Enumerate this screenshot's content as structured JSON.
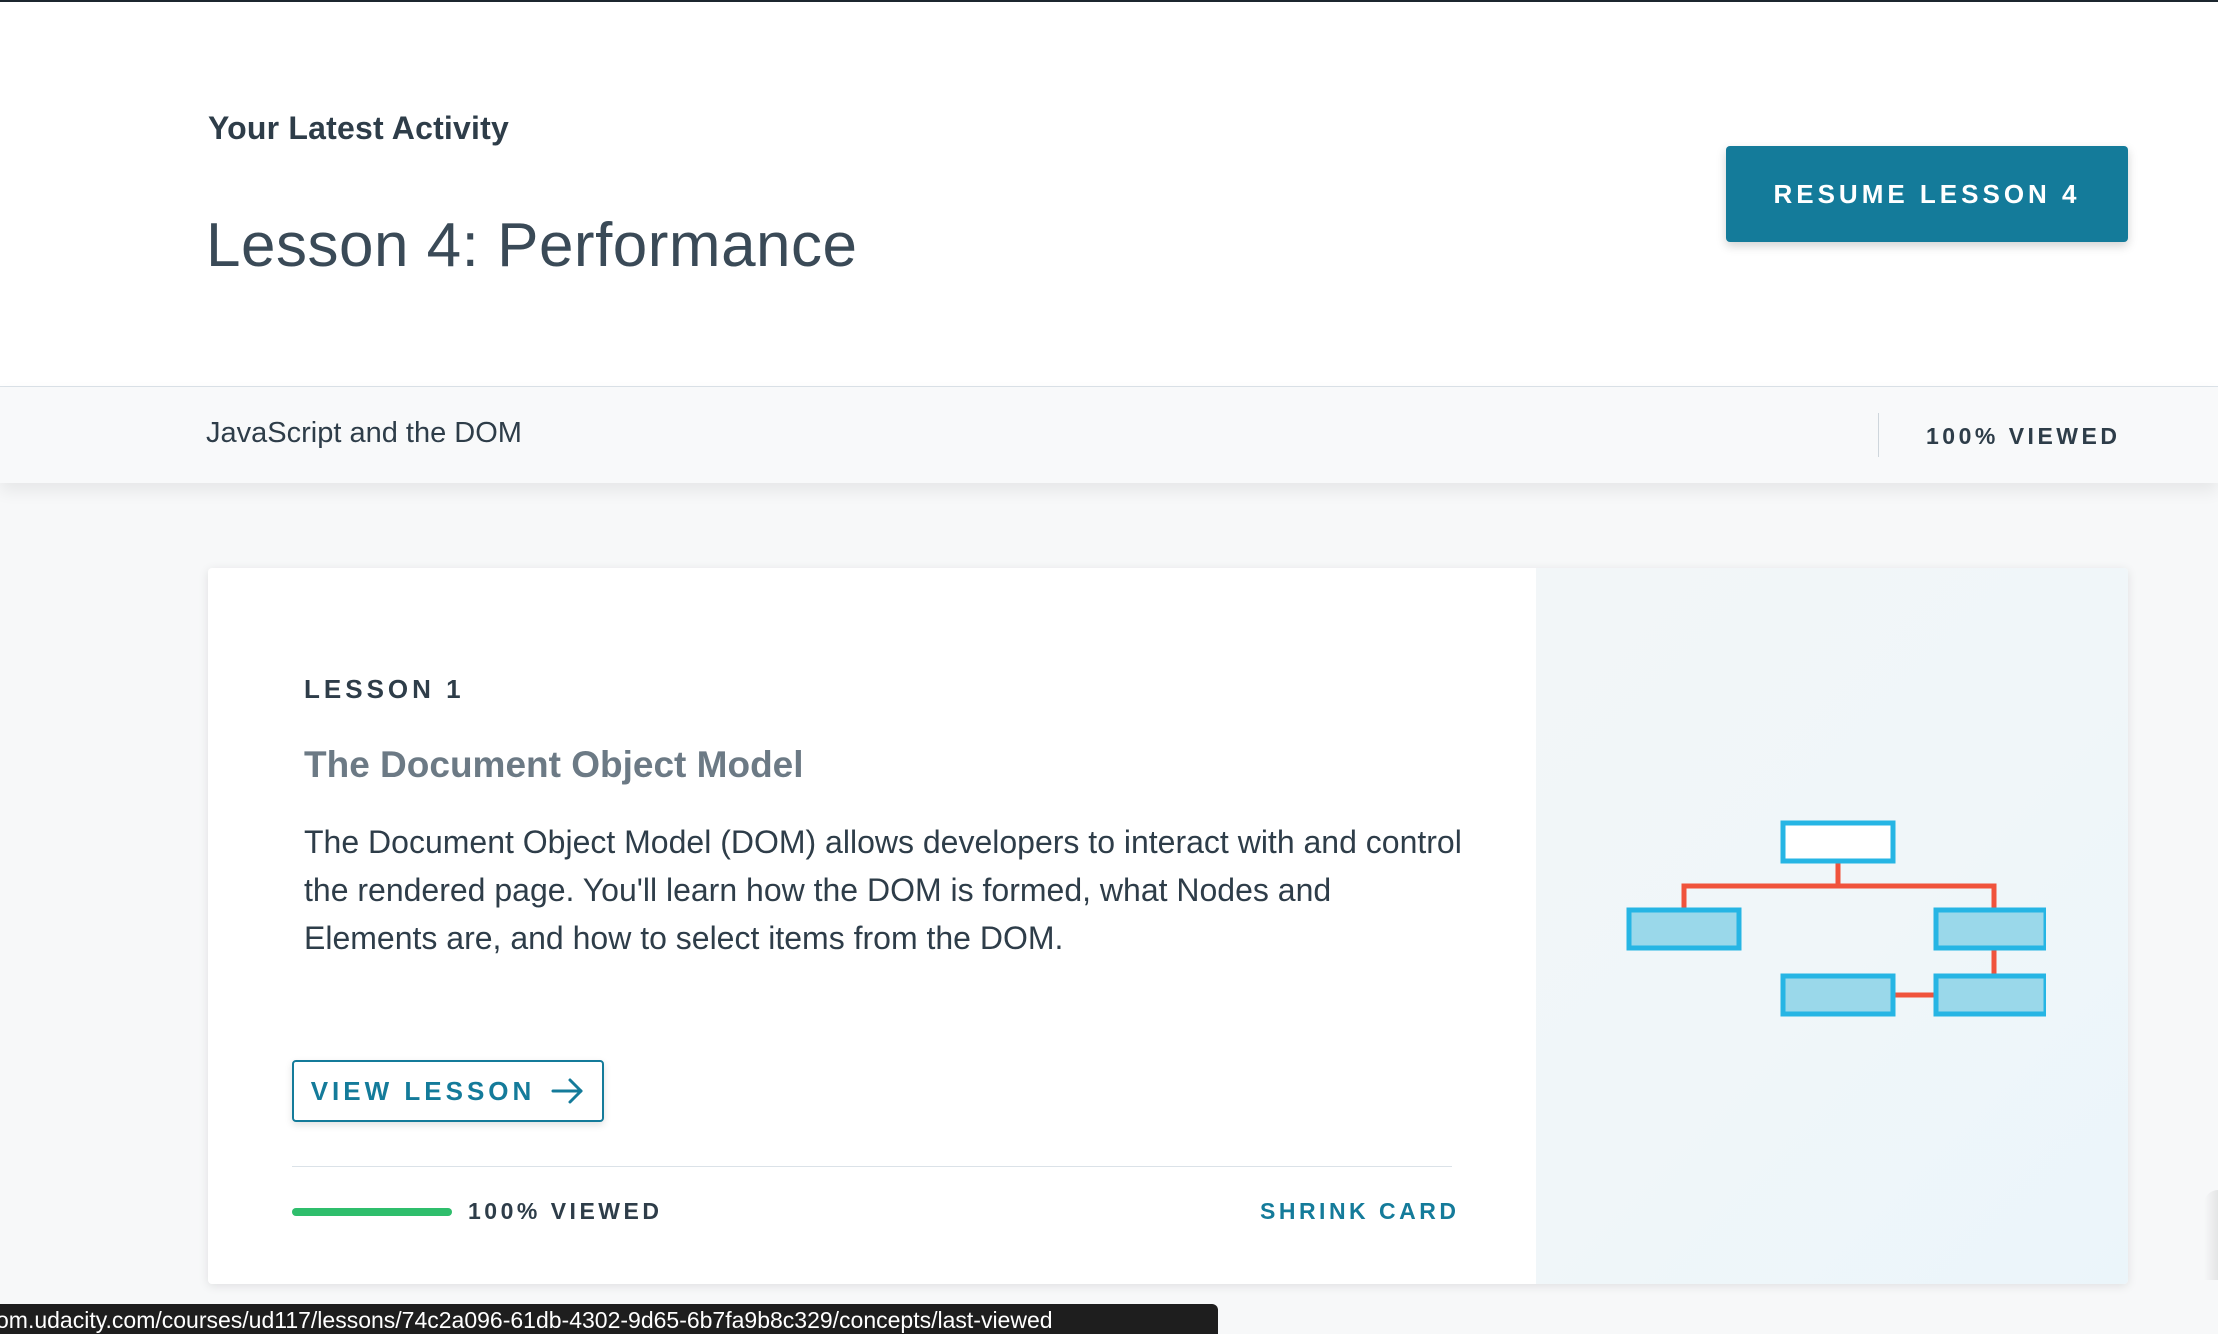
{
  "header": {
    "activity_label": "Your Latest Activity",
    "lesson_title": "Lesson 4: Performance",
    "resume_button": "RESUME LESSON 4"
  },
  "subbar": {
    "course_name": "JavaScript and the DOM",
    "viewed": "100% VIEWED"
  },
  "card": {
    "lesson_number": "LESSON 1",
    "title": "The Document Object Model",
    "description": "The Document Object Model (DOM) allows developers to interact with and control the rendered page. You'll learn how the DOM is formed, what Nodes and Elements are, and how to select items from the DOM.",
    "view_button": "VIEW LESSON",
    "progress_percent": 100,
    "viewed": "100% VIEWED",
    "shrink_link": "SHRINK CARD",
    "image_icon": "dom-tree-diagram-icon"
  },
  "status_bar": {
    "url": "om.udacity.com/courses/ud117/lessons/74c2a096-61db-4302-9d65-6b7fa9b8c329/concepts/last-viewed"
  },
  "colors": {
    "accent": "#147b9a",
    "progress": "#2fbe6c",
    "diagram_box_fill": "#9ad8ea",
    "diagram_box_stroke": "#26b5e4",
    "diagram_connector": "#f0533c"
  }
}
